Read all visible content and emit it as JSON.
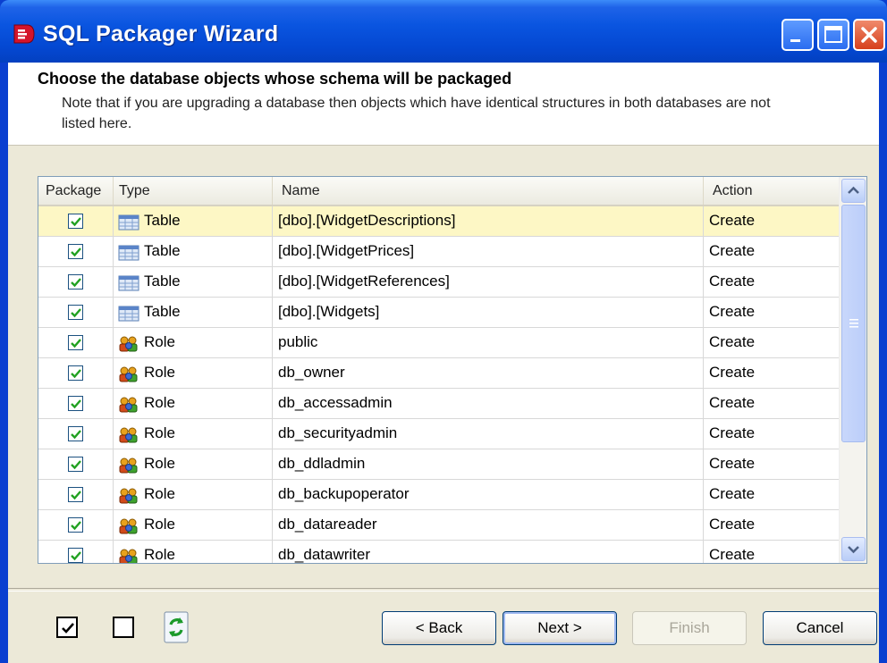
{
  "window": {
    "title": "SQL Packager Wizard",
    "controls": {
      "minimize": "minimize-icon",
      "maximize": "maximize-icon",
      "close": "close-icon"
    }
  },
  "header": {
    "title": "Choose the database objects whose schema will be packaged",
    "note": "Note that if you are upgrading a database then objects which have identical structures in both databases are not listed here."
  },
  "grid": {
    "columns": {
      "package": "Package",
      "type": "Type",
      "name": "Name",
      "action": "Action"
    },
    "rows": [
      {
        "checked": true,
        "type": "Table",
        "icon": "table-icon",
        "name": "[dbo].[WidgetDescriptions]",
        "action": "Create",
        "selected": true
      },
      {
        "checked": true,
        "type": "Table",
        "icon": "table-icon",
        "name": "[dbo].[WidgetPrices]",
        "action": "Create"
      },
      {
        "checked": true,
        "type": "Table",
        "icon": "table-icon",
        "name": "[dbo].[WidgetReferences]",
        "action": "Create"
      },
      {
        "checked": true,
        "type": "Table",
        "icon": "table-icon",
        "name": "[dbo].[Widgets]",
        "action": "Create"
      },
      {
        "checked": true,
        "type": "Role",
        "icon": "role-icon",
        "name": "public",
        "action": "Create"
      },
      {
        "checked": true,
        "type": "Role",
        "icon": "role-icon",
        "name": "db_owner",
        "action": "Create"
      },
      {
        "checked": true,
        "type": "Role",
        "icon": "role-icon",
        "name": "db_accessadmin",
        "action": "Create"
      },
      {
        "checked": true,
        "type": "Role",
        "icon": "role-icon",
        "name": "db_securityadmin",
        "action": "Create"
      },
      {
        "checked": true,
        "type": "Role",
        "icon": "role-icon",
        "name": "db_ddladmin",
        "action": "Create"
      },
      {
        "checked": true,
        "type": "Role",
        "icon": "role-icon",
        "name": "db_backupoperator",
        "action": "Create"
      },
      {
        "checked": true,
        "type": "Role",
        "icon": "role-icon",
        "name": "db_datareader",
        "action": "Create"
      },
      {
        "checked": true,
        "type": "Role",
        "icon": "role-icon",
        "name": "db_datawriter",
        "action": "Create"
      }
    ]
  },
  "toolbar": {
    "select_all_icon": "check-all-icon",
    "select_none_icon": "uncheck-all-icon",
    "refresh_icon": "refresh-icon"
  },
  "buttons": {
    "back": "< Back",
    "next": "Next >",
    "finish": "Finish",
    "cancel": "Cancel"
  },
  "colors": {
    "titlebar": "#0a55e0",
    "selected_row": "#fdf7c5",
    "check": "#21a121",
    "close_button": "#d6401d"
  }
}
